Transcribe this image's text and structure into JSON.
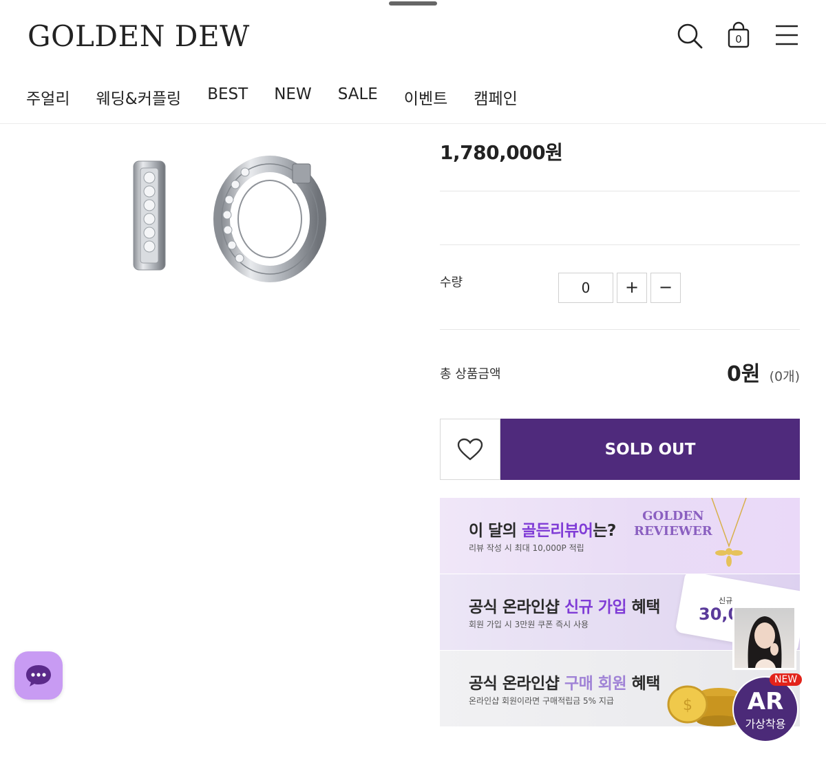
{
  "brand": {
    "logo": "GOLDEN DEW"
  },
  "header_icons": [
    "search-icon",
    "shopping-bag-icon",
    "hamburger-menu-icon"
  ],
  "cart": {
    "count": "0"
  },
  "nav": [
    "주얼리",
    "웨딩&커플링",
    "BEST",
    "NEW",
    "SALE",
    "이벤트",
    "캠페인"
  ],
  "product": {
    "price": "1,780,000원",
    "quantity_label": "수량",
    "quantity_value": "0",
    "plus_label": "+",
    "minus_label": "−",
    "total_label": "총 상품금액",
    "total_price": "0원",
    "total_count": "(0개)",
    "soldout_label": "SOLD OUT"
  },
  "banners": [
    {
      "title_pre": "이 달의 ",
      "title_hl": "골든리뷰어",
      "title_post": "는?",
      "sub": "리뷰 작성 시 최대 10,000P 적립",
      "badge_line1": "GOLDEN",
      "badge_line2": "REVIEWER"
    },
    {
      "title_pre": "공식 온라인샵 ",
      "title_hl": "신규 가입",
      "title_post": " 혜택",
      "sub": "회원 가입 시 3만원 쿠폰 즉시 사용",
      "card_small": "신규",
      "card_text": "30,0"
    },
    {
      "title_pre": "공식 온라인샵 ",
      "title_hl": "구매 회원",
      "title_post": " 혜택",
      "sub": "온라인샵 회원이라면 구매적립금 5% 지급"
    }
  ],
  "ar": {
    "main": "AR",
    "sub": "가상착용",
    "badge": "NEW"
  },
  "colors": {
    "soldout_bg": "#4f2a7c",
    "highlight": "#7f3bd6",
    "chat_bg": "#c89bf3",
    "ar_bg": "#4b2a78",
    "new_badge": "#e2231a"
  }
}
